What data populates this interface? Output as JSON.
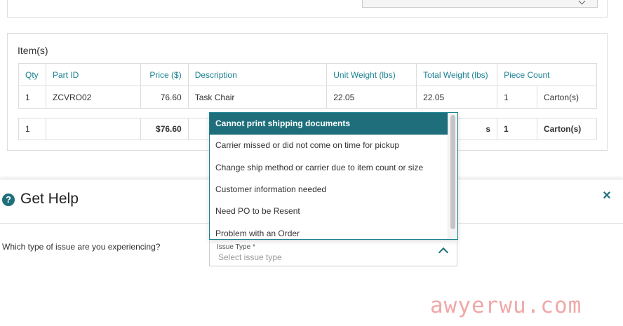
{
  "items_section": {
    "heading": "Item(s)",
    "columns": [
      "Qty",
      "Part ID",
      "Price ($)",
      "Description",
      "Unit Weight (lbs)",
      "Total Weight (lbs)",
      "Piece Count"
    ],
    "rows": [
      {
        "qty": "1",
        "part_id": "ZCVRO02",
        "price": "76.60",
        "description": "Task Chair",
        "unit_weight": "22.05",
        "total_weight": "22.05",
        "piece_count": "1",
        "unit_name": "Carton(s)"
      }
    ],
    "totals": {
      "qty": "1",
      "price": "$76.60",
      "total_weight_suffix": "s",
      "piece_count": "1",
      "unit_name": "Carton(s)"
    }
  },
  "help": {
    "title": "Get Help",
    "help_icon_text": "?",
    "close_icon_text": "×",
    "question": "Which type of issue are you experiencing?",
    "issue_label": "Issue Type *",
    "issue_placeholder": "Select issue type",
    "options": [
      "Cannot print shipping documents",
      "Carrier missed or did not come on time for pickup",
      "Change ship method or carrier due to item count or size",
      "Customer information needed",
      "Need PO to be Resent",
      "Problem with an Order"
    ],
    "active_option_index": 0
  },
  "watermark": "awyerwu.com",
  "colors": {
    "accent": "#1e6f7b",
    "header_text": "#1a8191"
  }
}
